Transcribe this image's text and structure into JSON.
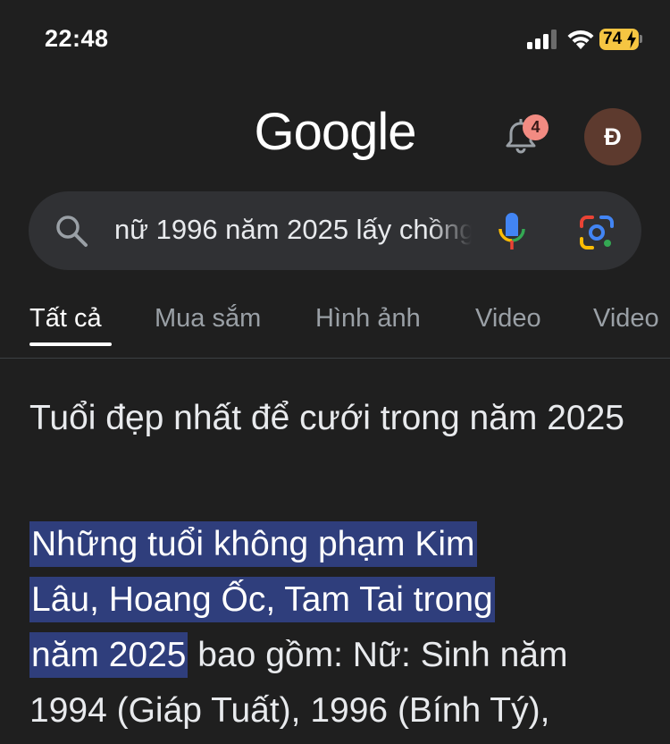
{
  "status": {
    "time": "22:48",
    "battery": "74"
  },
  "header": {
    "logo": "Google",
    "notification_count": "4",
    "avatar_initial": "Đ"
  },
  "search": {
    "query": "nữ 1996 năm 2025 lấy chồng"
  },
  "tabs": [
    {
      "label": "Tất cả",
      "active": true
    },
    {
      "label": "Mua sắm"
    },
    {
      "label": "Hình ảnh"
    },
    {
      "label": "Video"
    },
    {
      "label": "Video"
    }
  ],
  "result": {
    "title": "Tuổi đẹp nhất để cưới trong năm 2025",
    "highlight_line1": "Những tuổi không phạm Kim",
    "highlight_line2": "Lâu, Hoang Ốc, Tam Tai trong",
    "highlight_line3": "năm 2025",
    "rest_line3": " bao gồm: Nữ: Sinh năm",
    "line4": "1994 (Giáp Tuất), 1996 (Bính Tý),"
  },
  "colors": {
    "background": "#1f1f1f",
    "search_bg": "#303134",
    "highlight": "#2f3e7c",
    "badge": "#f28b82",
    "battery": "#f5c542"
  }
}
